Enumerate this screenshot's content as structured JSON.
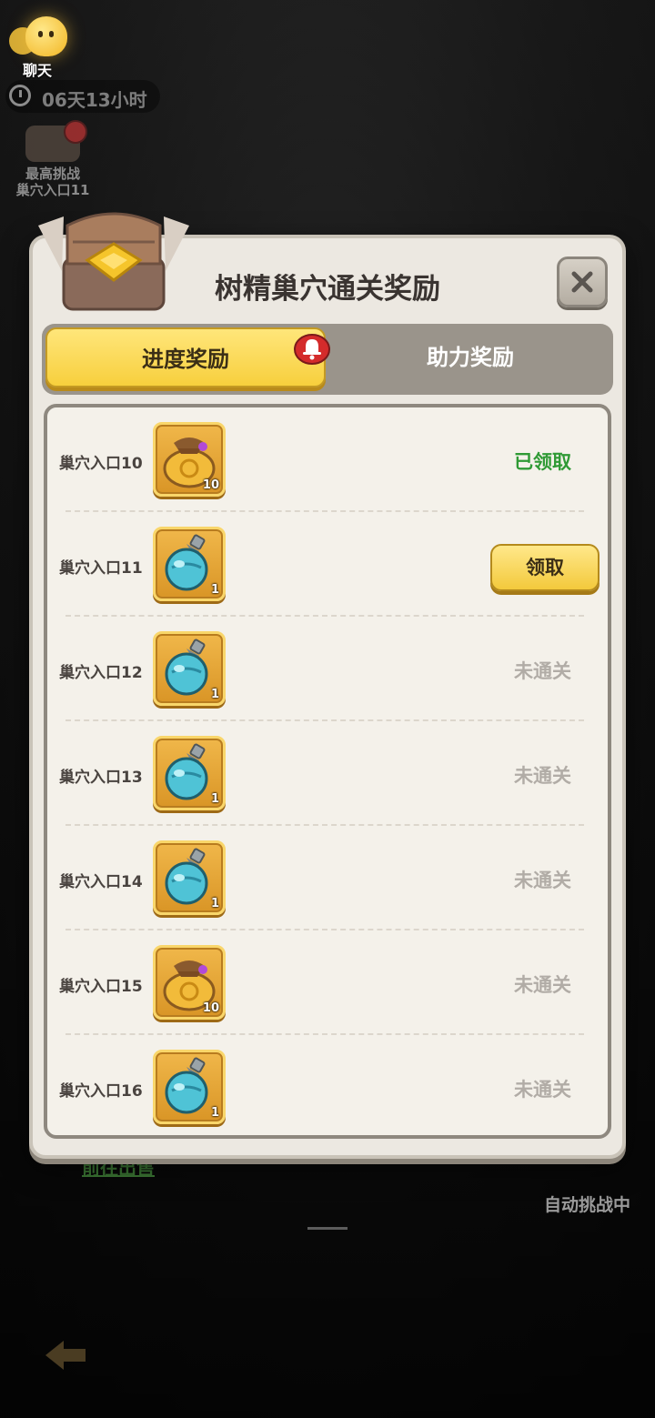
{
  "hud": {
    "chat_label": "聊天",
    "timer_text": "06天13小时",
    "best_label_line1": "最高挑战",
    "best_label_line2": "巢穴入口11"
  },
  "background": {
    "goto_text": "前往出售",
    "auto_text": "自动挑战中"
  },
  "dialog": {
    "title": "树精巢穴通关奖励",
    "tabs": [
      {
        "label": "进度奖励",
        "active": true
      },
      {
        "label": "助力奖励",
        "active": false
      }
    ],
    "rows": [
      {
        "name": "巢穴入口10",
        "item_icon": "coin-bag-icon",
        "quantity": "10",
        "status": "已领取",
        "state": "claimed"
      },
      {
        "name": "巢穴入口11",
        "item_icon": "crystal-potion-icon",
        "quantity": "1",
        "status": "领取",
        "state": "claimable"
      },
      {
        "name": "巢穴入口12",
        "item_icon": "crystal-potion-icon",
        "quantity": "1",
        "status": "未通关",
        "state": "locked"
      },
      {
        "name": "巢穴入口13",
        "item_icon": "crystal-potion-icon",
        "quantity": "1",
        "status": "未通关",
        "state": "locked"
      },
      {
        "name": "巢穴入口14",
        "item_icon": "crystal-potion-icon",
        "quantity": "1",
        "status": "未通关",
        "state": "locked"
      },
      {
        "name": "巢穴入口15",
        "item_icon": "coin-bag-icon",
        "quantity": "10",
        "status": "未通关",
        "state": "locked"
      },
      {
        "name": "巢穴入口16",
        "item_icon": "crystal-potion-icon",
        "quantity": "1",
        "status": "未通关",
        "state": "locked"
      }
    ]
  },
  "colors": {
    "claimed": "#2f9a35",
    "locked": "#b1aca6",
    "tab_active": "#f7cf3d"
  }
}
